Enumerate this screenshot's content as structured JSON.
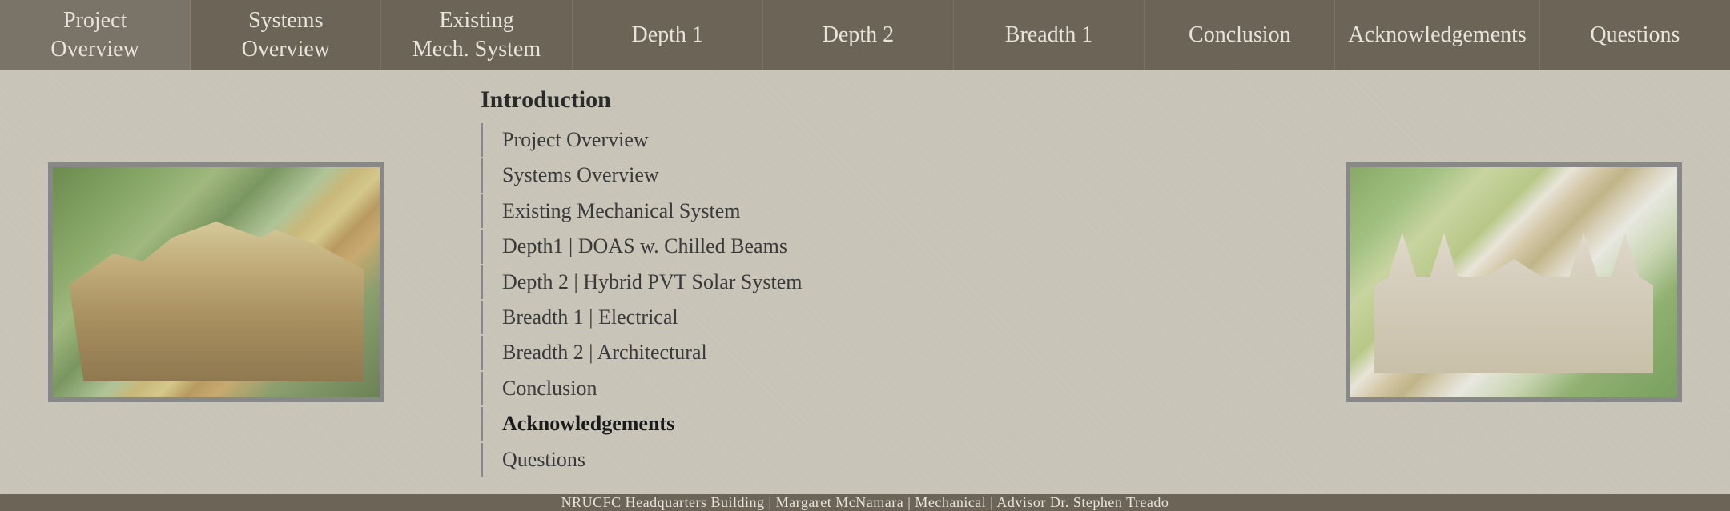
{
  "navbar": {
    "items": [
      {
        "id": "project-overview",
        "label": "Project\nOverview",
        "active": false
      },
      {
        "id": "systems-overview",
        "label": "Systems\nOverview",
        "active": false
      },
      {
        "id": "existing-mech",
        "label": "Existing\nMech. System",
        "active": false
      },
      {
        "id": "depth-1",
        "label": "Depth 1",
        "active": false
      },
      {
        "id": "depth-2",
        "label": "Depth 2",
        "active": false
      },
      {
        "id": "breadth-1",
        "label": "Breadth 1",
        "active": false
      },
      {
        "id": "conclusion",
        "label": "Conclusion",
        "active": false
      },
      {
        "id": "acknowledgements",
        "label": "Acknowledgements",
        "active": false
      },
      {
        "id": "questions",
        "label": "Questions",
        "active": false
      }
    ]
  },
  "menu": {
    "title": "Introduction",
    "items": [
      {
        "id": "project-overview",
        "label": "Project Overview",
        "bold": false
      },
      {
        "id": "systems-overview",
        "label": "Systems Overview",
        "bold": false
      },
      {
        "id": "existing-mech",
        "label": "Existing Mechanical System",
        "bold": false
      },
      {
        "id": "depth1",
        "label": "Depth1 | DOAS w. Chilled Beams",
        "bold": false
      },
      {
        "id": "depth2",
        "label": "Depth 2 | Hybrid PVT Solar System",
        "bold": false
      },
      {
        "id": "breadth1",
        "label": "Breadth 1 | Electrical",
        "bold": false
      },
      {
        "id": "breadth2",
        "label": "Breadth 2 | Architectural",
        "bold": false
      },
      {
        "id": "conclusion",
        "label": "Conclusion",
        "bold": false
      },
      {
        "id": "acknowledgements",
        "label": "Acknowledgements",
        "bold": true
      },
      {
        "id": "questions",
        "label": "Questions",
        "bold": false
      }
    ]
  },
  "footer": {
    "text": "NRUCFC Headquarters Building | Margaret McNamara | Mechanical | Advisor Dr. Stephen Treado"
  }
}
